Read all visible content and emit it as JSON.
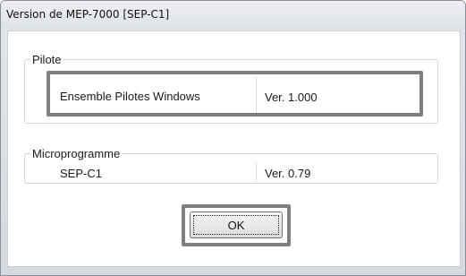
{
  "window": {
    "title": "Version de MEP-7000 [SEP-C1]"
  },
  "driver_group": {
    "label": "Pilote",
    "name": "Ensemble Pilotes Windows",
    "version": "Ver. 1.000"
  },
  "firmware_group": {
    "label": "Microprogramme",
    "name": "SEP-C1",
    "version": "Ver. 0.79"
  },
  "buttons": {
    "ok": "OK"
  }
}
